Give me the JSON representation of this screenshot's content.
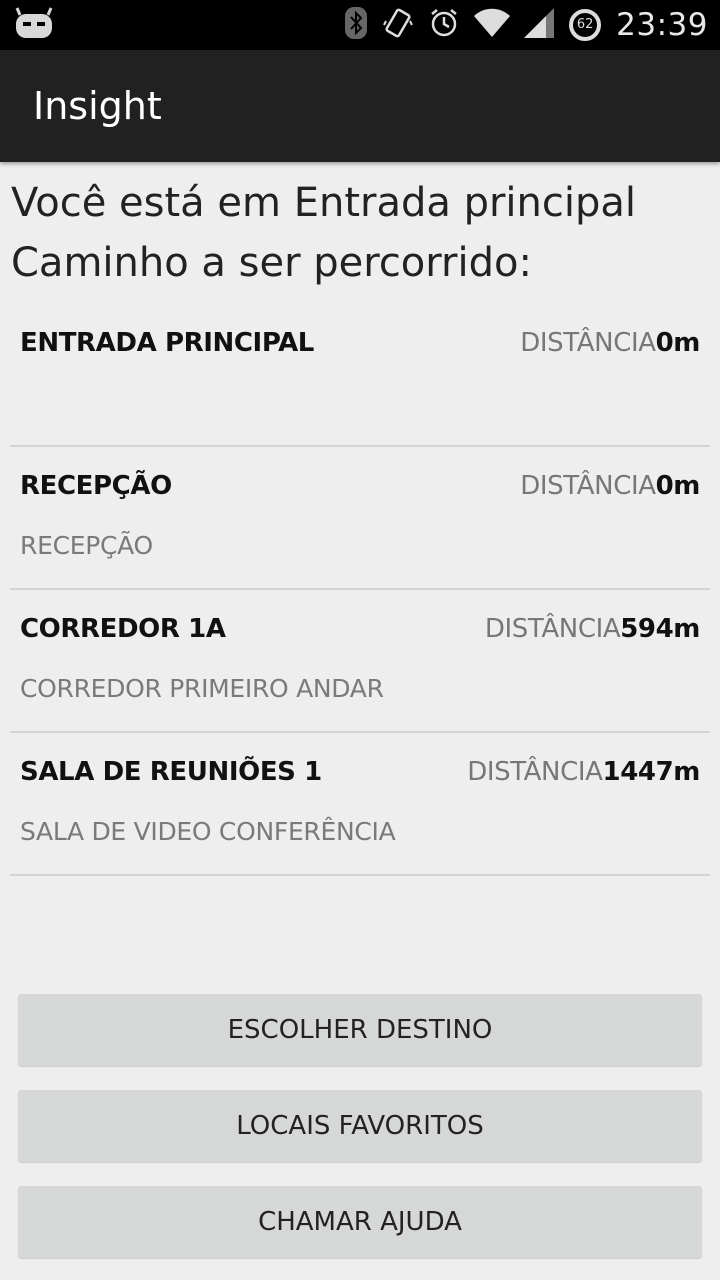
{
  "status_bar": {
    "time": "23:39",
    "battery_level": "62",
    "icons": [
      "cyanogen-mascot-icon",
      "bluetooth-icon",
      "vibrate-icon",
      "alarm-icon",
      "wifi-icon",
      "signal-icon",
      "battery-icon"
    ]
  },
  "app": {
    "title": "Insight"
  },
  "location": {
    "current": "Você está em Entrada principal",
    "path_label": "Caminho a ser percorrido:"
  },
  "route": [
    {
      "name": "ENTRADA PRINCIPAL",
      "distance_label": "DISTÂNCIA",
      "distance": "0m",
      "description": ""
    },
    {
      "name": "RECEPÇÃO",
      "distance_label": "DISTÂNCIA",
      "distance": "0m",
      "description": "RECEPÇÃO"
    },
    {
      "name": "CORREDOR 1A",
      "distance_label": "DISTÂNCIA",
      "distance": "594m",
      "description": "CORREDOR PRIMEIRO ANDAR"
    },
    {
      "name": "SALA DE REUNIÕES 1",
      "distance_label": "DISTÂNCIA",
      "distance": "1447m",
      "description": "SALA DE VIDEO CONFERÊNCIA"
    }
  ],
  "buttons": {
    "choose_destination": "ESCOLHER DESTINO",
    "favorites": "LOCAIS FAVORITOS",
    "call_help": "CHAMAR AJUDA"
  },
  "colors": {
    "status_bar": "#000000",
    "action_bar": "#212121",
    "background": "#eeeeee",
    "button": "#d6d7d7",
    "divider": "#d4d4d4"
  }
}
